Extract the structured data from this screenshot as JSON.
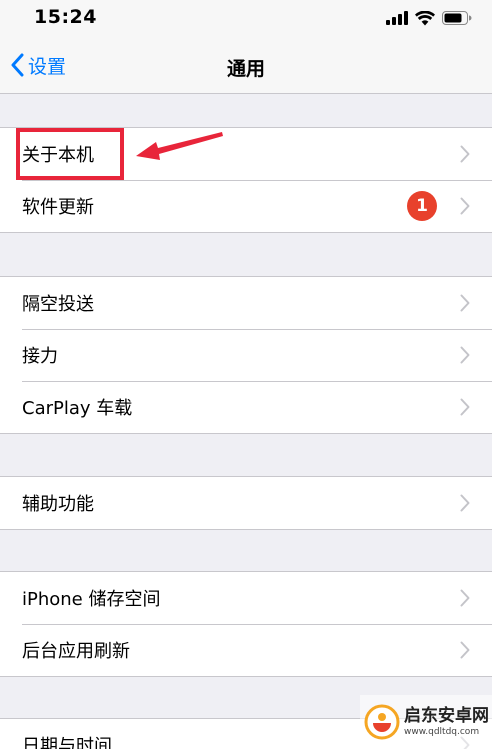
{
  "status_bar": {
    "time": "15:24"
  },
  "nav": {
    "back_label": "设置",
    "title": "通用"
  },
  "groups": [
    {
      "rows": [
        {
          "label": "关于本机"
        },
        {
          "label": "软件更新",
          "badge": "1"
        }
      ]
    },
    {
      "rows": [
        {
          "label": "隔空投送"
        },
        {
          "label": "接力"
        },
        {
          "label": "CarPlay 车载"
        }
      ]
    },
    {
      "rows": [
        {
          "label": "辅助功能"
        }
      ]
    },
    {
      "rows": [
        {
          "label": "iPhone 储存空间"
        },
        {
          "label": "后台应用刷新"
        }
      ]
    },
    {
      "rows": [
        {
          "label": "日期与时间"
        }
      ]
    }
  ],
  "watermark": {
    "brand": "启东安卓网",
    "url": "www.qdltdq.com"
  },
  "colors": {
    "accent": "#007aff",
    "badge": "#e8412c",
    "annotation": "#e8253a",
    "background": "#efeff4"
  },
  "icons": {
    "back": "chevron-left-icon",
    "row_disclosure": "chevron-right-icon",
    "signal": "cellular-signal-icon",
    "wifi": "wifi-icon",
    "battery": "battery-icon"
  }
}
